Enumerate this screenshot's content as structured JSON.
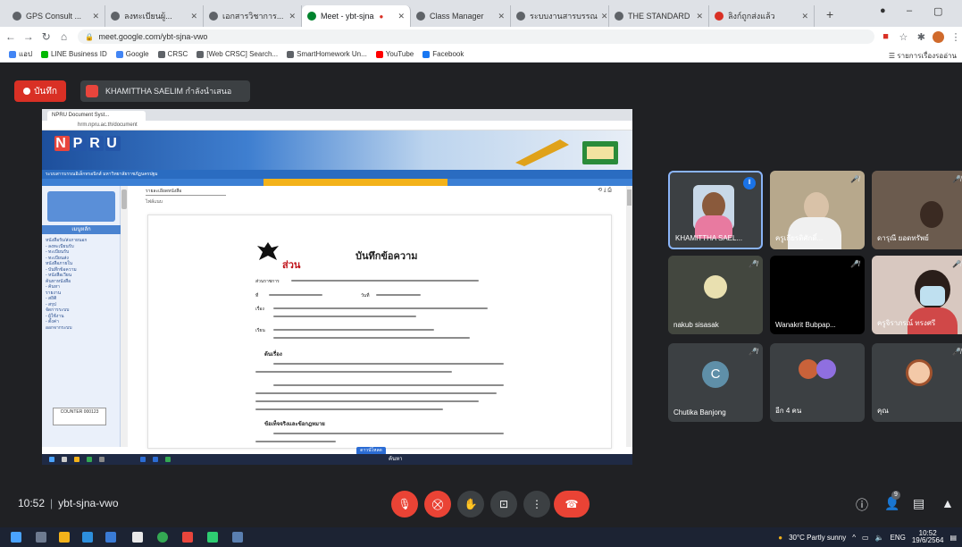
{
  "browser": {
    "tabs": [
      {
        "label": "GPS Consult ...",
        "active": false
      },
      {
        "label": "ลงทะเบียนผู้...",
        "active": false
      },
      {
        "label": "เอกสารวิชาการ...",
        "active": false
      },
      {
        "label": "Meet - ybt-sjna",
        "active": true
      },
      {
        "label": "Class Manager",
        "active": false
      },
      {
        "label": "ระบบงานสารบรรณ",
        "active": false
      },
      {
        "label": "THE STANDARD",
        "active": false
      },
      {
        "label": "ลิงก์ถูกส่งแล้ว",
        "active": false
      }
    ],
    "url": "meet.google.com/ybt-sjna-vwo",
    "bookmarks": [
      {
        "label": "แอป",
        "color": "#4285f4"
      },
      {
        "label": "LINE Business ID",
        "color": "#00b900"
      },
      {
        "label": "Google",
        "color": "#4285f4"
      },
      {
        "label": "CRSC",
        "color": "#5f6368"
      },
      {
        "label": "[Web CRSC] Search...",
        "color": "#5f6368"
      },
      {
        "label": "SmartHomework Un...",
        "color": "#5f6368"
      },
      {
        "label": "YouTube",
        "color": "#ff0000"
      },
      {
        "label": "Facebook",
        "color": "#1877f2"
      }
    ],
    "bookmarks_right": "รายการเรื่องรออ่าน"
  },
  "meet": {
    "recording_label": "บันทึก",
    "presenter_label": "KHAMITTHA SAELIM กำลังนำเสนอ",
    "time": "10:52",
    "meeting_code": "ybt-sjna-vwo",
    "participants": [
      {
        "name": "KHAMITTHA SAEL...",
        "kind": "video",
        "speaking": true
      },
      {
        "name": "ครูเกียรติศักดิ์...",
        "kind": "video",
        "speaking": false
      },
      {
        "name": "ดารุณี ยอดทรัพย์",
        "kind": "video",
        "speaking": false
      },
      {
        "name": "nakub sisasak",
        "kind": "video",
        "speaking": false
      },
      {
        "name": "Wanakrit Bubpap...",
        "kind": "dark",
        "speaking": false
      },
      {
        "name": "ครูจิราภรณ์ ทรงศรี",
        "kind": "video",
        "speaking": false
      },
      {
        "name": "Chutika Banjong",
        "kind": "letter",
        "letter": "C",
        "speaking": false
      },
      {
        "name": "อีก 4 คน",
        "kind": "group",
        "speaking": false
      },
      {
        "name": "คุณ",
        "kind": "self",
        "speaking": false
      }
    ]
  },
  "shared": {
    "tab_label": "NPRU Document Syst...",
    "address": "hrm.npru.ac.th/document",
    "logo": "NPRU",
    "nav_text": "ระบบสารบรรณอิเล็กทรอนิกส์ มหาวิทยาลัยราชภัฏนครปฐม",
    "panel_title": "รายละเอียดหนังสือ",
    "panel_sub": "ไฟล์แนบ",
    "sidebar_title": "เมนูหลัก",
    "sidebar_items": [
      "หนังสือรับ/ส่งภายนอก",
      "- ลงทะเบียนรับ",
      "- ทะเบียนรับ",
      "- ทะเบียนส่ง",
      "หนังสือภายใน",
      "- บันทึกข้อความ",
      "- หนังสือเวียน",
      "ค้นหาหนังสือ",
      "- ค้นหา",
      "รายงาน",
      "- สถิติ",
      "- สรุป",
      "จัดการระบบ",
      "- ผู้ใช้งาน",
      "- ตั้งค่า",
      "ออกจากระบบ"
    ],
    "sidebar_footer": "COUNTER 000123",
    "doc_header_red": "ส่วน",
    "doc_title": "บันทึกข้อความ",
    "doc_labels": [
      "ส่วนราชการ",
      "ที่",
      "วันที่",
      "เรื่อง",
      "เรียน",
      "ต้นเรื่อง",
      "ข้อเท็จจริงและข้อกฎหมาย"
    ],
    "blue_button": "ดาวน์โหลด",
    "taskbar_text": "ค้นหา"
  },
  "taskbar": {
    "weather": "30°C Partly sunny",
    "lang": "ENG",
    "time": "10:52",
    "date": "19/6/2564"
  }
}
